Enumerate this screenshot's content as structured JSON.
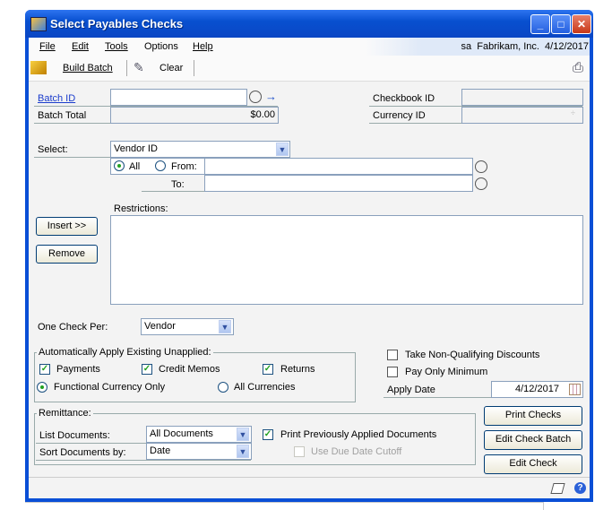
{
  "window": {
    "title": "Select Payables Checks",
    "title_bar_color": "#0a50d0"
  },
  "menu": {
    "items": [
      "File",
      "Edit",
      "Tools",
      "Options",
      "Help"
    ],
    "status": "sa  Fabrikam, Inc.  4/12/2017"
  },
  "toolbar": {
    "build_batch": "Build Batch",
    "clear": "Clear",
    "icons": [
      "build-batch-icon",
      "clear-eraser-icon",
      "printer-icon"
    ]
  },
  "header": {
    "batch_id_label": "Batch ID",
    "batch_id_value": "",
    "batch_total_label": "Batch Total",
    "batch_total_value": "$0.00",
    "checkbook_id_label": "Checkbook ID",
    "checkbook_id_value": "",
    "currency_id_label": "Currency ID",
    "currency_id_value": ""
  },
  "select": {
    "label": "Select:",
    "value": "Vendor ID",
    "all_label": "All",
    "from_label": "From:",
    "to_label": "To:",
    "range_mode": "All",
    "from_value": "",
    "to_value": ""
  },
  "restrictions": {
    "label": "Restrictions:",
    "insert": "Insert >>",
    "remove": "Remove",
    "items": []
  },
  "one_check": {
    "label": "One Check Per:",
    "value": "Vendor"
  },
  "auto_apply": {
    "label": "Automatically Apply Existing Unapplied:",
    "payments": "Payments",
    "payments_checked": true,
    "credit_memos": "Credit Memos",
    "credit_memos_checked": true,
    "returns": "Returns",
    "returns_checked": true,
    "functional": "Functional Currency Only",
    "all_currencies": "All Currencies",
    "currency_mode": "Functional Currency Only"
  },
  "options": {
    "take_non_qualifying": "Take Non-Qualifying Discounts",
    "take_non_qualifying_checked": false,
    "pay_only_minimum": "Pay Only Minimum",
    "pay_only_minimum_checked": false,
    "apply_date_label": "Apply Date",
    "apply_date_value": "4/12/2017"
  },
  "remittance": {
    "label": "Remittance:",
    "list_documents_label": "List Documents:",
    "list_documents_value": "All Documents",
    "sort_label": "Sort Documents by:",
    "sort_value": "Date",
    "print_prev": "Print Previously Applied Documents",
    "print_prev_checked": true,
    "use_due_date": "Use Due Date Cutoff",
    "use_due_date_checked": false
  },
  "buttons": {
    "print_checks": "Print Checks",
    "edit_check_batch": "Edit Check Batch",
    "edit_check": "Edit Check"
  }
}
